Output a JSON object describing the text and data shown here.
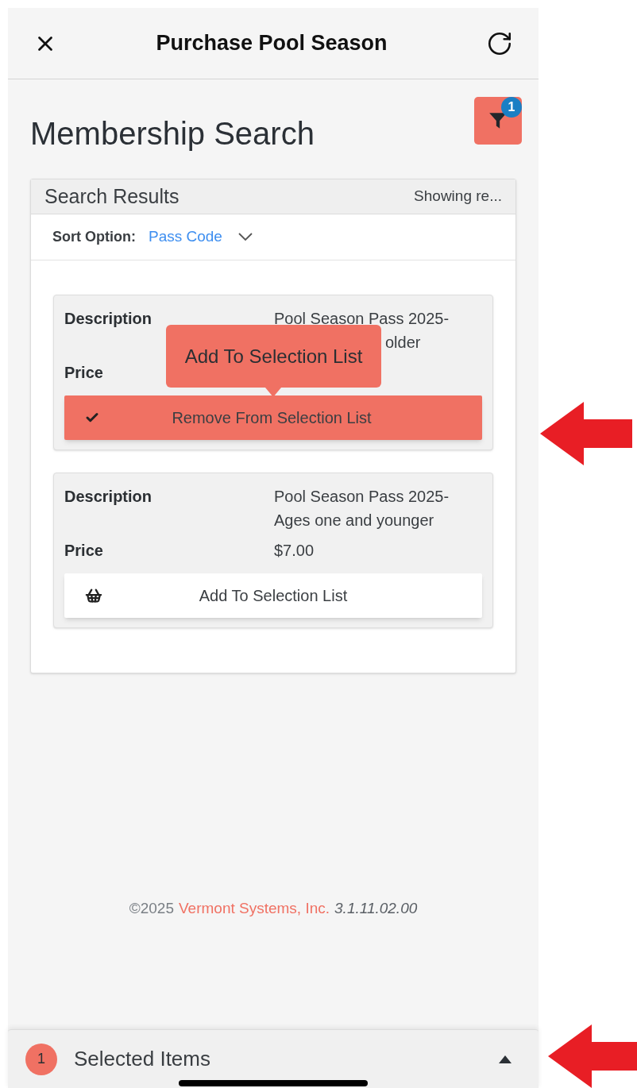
{
  "header": {
    "title": "Purchase Pool Season"
  },
  "page_title": "Membership Search",
  "filter": {
    "badge": "1"
  },
  "results": {
    "title": "Search Results",
    "showing": "Showing re...",
    "sort_label": "Sort Option:",
    "sort_value": "Pass Code"
  },
  "items": [
    {
      "description_label": "Description",
      "description_lines": [
        "Pool Season Pass 2025-",
        "older"
      ],
      "price_label": "Price",
      "selected": true,
      "button": "Remove From Selection List",
      "tooltip": "Add To Selection List"
    },
    {
      "description_label": "Description",
      "description_lines": [
        "Pool Season Pass 2025-",
        "Ages one and younger"
      ],
      "price_label": "Price",
      "price": "$7.00",
      "selected": false,
      "button": "Add To Selection List"
    }
  ],
  "footer": {
    "copyright": "©2025",
    "company": "Vermont Systems, Inc.",
    "version": "3.1.11.02.00"
  },
  "selected_bar": {
    "count": "1",
    "label": "Selected Items"
  }
}
